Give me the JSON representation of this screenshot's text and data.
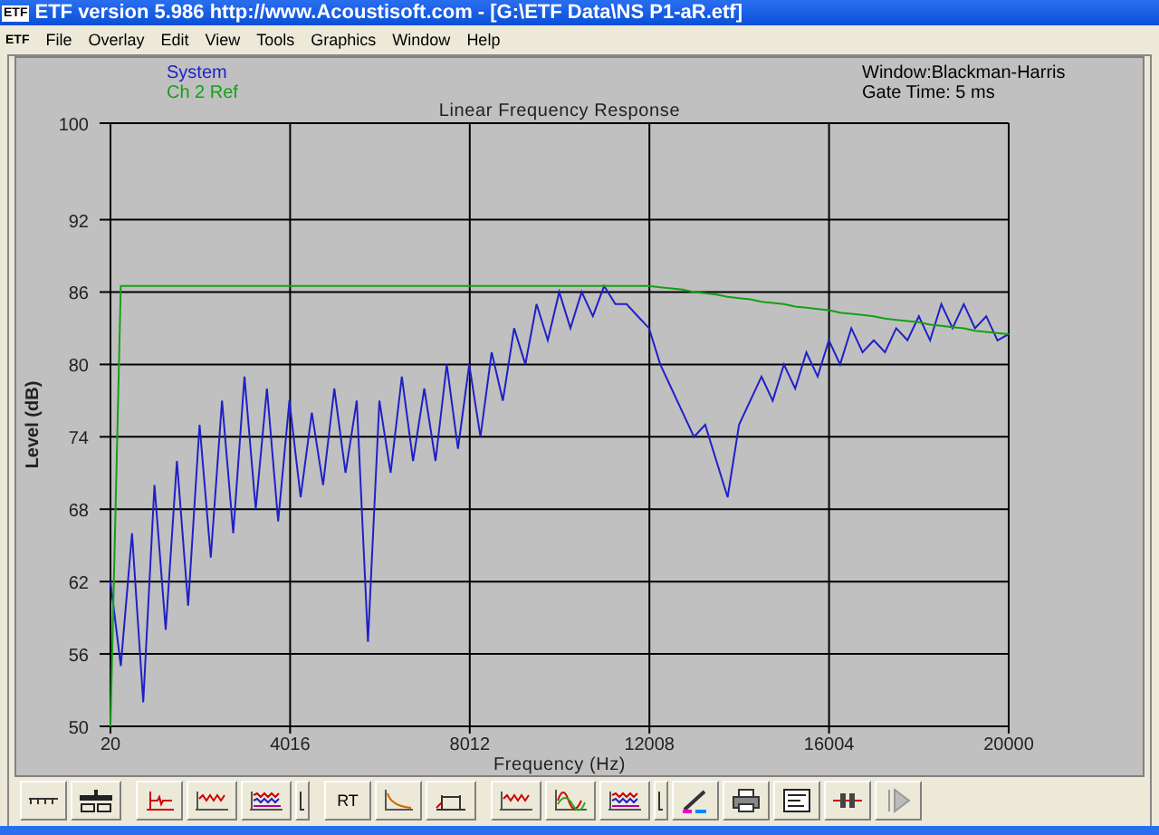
{
  "window": {
    "icon_text": "ETF",
    "title": "ETF version 5.986 http://www.Acoustisoft.com - [G:\\ETF Data\\NS P1-aR.etf]"
  },
  "menu": {
    "icon_text": "ETF",
    "items": [
      "File",
      "Overlay",
      "Edit",
      "View",
      "Tools",
      "Graphics",
      "Window",
      "Help"
    ]
  },
  "info": [
    "Window:Blackman-Harris",
    "Gate Time: 5 ms"
  ],
  "chart_data": {
    "type": "line",
    "title": "Linear Frequency Response",
    "xlabel": "Frequency (Hz)",
    "ylabel": "Level (dB)",
    "x": [
      20,
      250,
      500,
      750,
      1000,
      1250,
      1500,
      1750,
      2000,
      2250,
      2500,
      2750,
      3000,
      3250,
      3500,
      3750,
      4000,
      4250,
      4500,
      4750,
      5000,
      5250,
      5500,
      5750,
      6000,
      6250,
      6500,
      6750,
      7000,
      7250,
      7500,
      7750,
      8000,
      8250,
      8500,
      8750,
      9000,
      9250,
      9500,
      9750,
      10000,
      10250,
      10500,
      10750,
      11000,
      11250,
      11500,
      11750,
      12000,
      12250,
      12500,
      12750,
      13000,
      13250,
      13500,
      13750,
      14000,
      14250,
      14500,
      14750,
      15000,
      15250,
      15500,
      15750,
      16000,
      16250,
      16500,
      16750,
      17000,
      17250,
      17500,
      17750,
      18000,
      18250,
      18500,
      18750,
      19000,
      19250,
      19500,
      19750,
      20000
    ],
    "series": [
      {
        "name": "System",
        "color": "#2020c8",
        "values": [
          62,
          55,
          66,
          52,
          70,
          58,
          72,
          60,
          75,
          64,
          77,
          66,
          79,
          68,
          78,
          67,
          77,
          69,
          76,
          70,
          78,
          71,
          77,
          57,
          77,
          71,
          79,
          72,
          78,
          72,
          80,
          73,
          80,
          74,
          81,
          77,
          83,
          80,
          85,
          82,
          86,
          83,
          86,
          84,
          86.5,
          85,
          85,
          84,
          83,
          80,
          78,
          76,
          74,
          75,
          72,
          69,
          75,
          77,
          79,
          77,
          80,
          78,
          81,
          79,
          82,
          80,
          83,
          81,
          82,
          81,
          83,
          82,
          84,
          82,
          85,
          83,
          85,
          83,
          84,
          82,
          82.5
        ]
      },
      {
        "name": "Ch 2  Ref",
        "color": "#14a014",
        "values": [
          50,
          86.5,
          86.5,
          86.5,
          86.5,
          86.5,
          86.5,
          86.5,
          86.5,
          86.5,
          86.5,
          86.5,
          86.5,
          86.5,
          86.5,
          86.5,
          86.5,
          86.5,
          86.5,
          86.5,
          86.5,
          86.5,
          86.5,
          86.5,
          86.5,
          86.5,
          86.5,
          86.5,
          86.5,
          86.5,
          86.5,
          86.5,
          86.5,
          86.5,
          86.5,
          86.5,
          86.5,
          86.5,
          86.5,
          86.5,
          86.5,
          86.5,
          86.5,
          86.5,
          86.5,
          86.5,
          86.5,
          86.5,
          86.5,
          86.4,
          86.3,
          86.2,
          86.0,
          85.9,
          85.8,
          85.6,
          85.5,
          85.4,
          85.2,
          85.1,
          85.0,
          84.8,
          84.7,
          84.6,
          84.5,
          84.3,
          84.2,
          84.1,
          84.0,
          83.8,
          83.7,
          83.6,
          83.5,
          83.3,
          83.2,
          83.1,
          83.0,
          82.8,
          82.7,
          82.6,
          82.5
        ]
      }
    ],
    "grid": true,
    "xlim": [
      20,
      20000
    ],
    "ylim": [
      50,
      100
    ],
    "xticks": [
      20,
      4016,
      8012,
      12008,
      16004,
      20000
    ],
    "yticks": [
      50,
      56,
      62,
      68,
      74,
      80,
      86,
      92,
      100
    ]
  },
  "toolbar_groups": [
    {
      "buttons": [
        {
          "kind": "flat"
        },
        {
          "kind": "sliders"
        }
      ]
    },
    {
      "buttons": [
        {
          "kind": "impulse"
        },
        {
          "kind": "wave"
        },
        {
          "kind": "multiwave"
        },
        {
          "kind": "drop"
        }
      ]
    },
    {
      "buttons": [
        {
          "kind": "text",
          "label": "RT"
        },
        {
          "kind": "decay"
        },
        {
          "kind": "gate"
        }
      ]
    },
    {
      "buttons": [
        {
          "kind": "wave"
        },
        {
          "kind": "sine"
        },
        {
          "kind": "multiwave"
        },
        {
          "kind": "drop"
        },
        {
          "kind": "pen"
        },
        {
          "kind": "printer"
        },
        {
          "kind": "props"
        },
        {
          "kind": "marker"
        },
        {
          "kind": "play"
        }
      ]
    }
  ]
}
